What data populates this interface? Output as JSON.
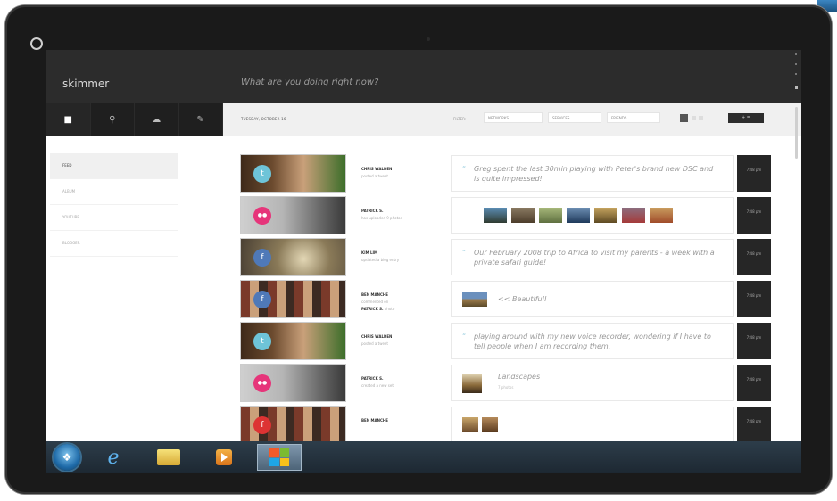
{
  "app": {
    "logo": "skimmer",
    "status_placeholder": "What are you doing right now?"
  },
  "nav_icons": [
    {
      "icon": "home-icon",
      "glyph": "■"
    },
    {
      "icon": "pin-icon",
      "glyph": "⚲"
    },
    {
      "icon": "cloud-icon",
      "glyph": "☁"
    },
    {
      "icon": "edit-icon",
      "glyph": "✎"
    }
  ],
  "filter_bar": {
    "date": "TUESDAY, OCTOBER 16",
    "filter_label": "FILTER:",
    "networks": "NETWORKS",
    "services": "SERVICES",
    "friends": "FRIENDS",
    "post_label": "+ ="
  },
  "sidebar": {
    "items": [
      {
        "label": "FEED",
        "active": true
      },
      {
        "label": "ALBUM",
        "active": false
      },
      {
        "label": "YOUTUBE",
        "active": false
      },
      {
        "label": "BLOGGER",
        "active": false
      }
    ]
  },
  "feed": [
    {
      "service": "twitter",
      "badge_glyph": "t",
      "badge_color": "#6ec4d8",
      "who": "CHRIS WALDEN",
      "what": "posted a tweet",
      "message": "Greg spent the last 30min playing with Peter's brand new DSC and is quite impressed!",
      "time": "7:48 pm"
    },
    {
      "service": "flickr",
      "badge_glyph": "●●",
      "badge_color": "#e6357a",
      "who": "PATRICK S.",
      "what": "has uploaded 9 photos",
      "photo_count": 9,
      "time": "7:48 pm"
    },
    {
      "service": "facebook",
      "badge_glyph": "f",
      "badge_color": "#4f79b8",
      "who": "KIM LIM",
      "what": "updated a blog entry",
      "message": "Our February 2008 trip to Africa to visit my parents - a week with a private safari guide!",
      "time": "7:48 pm"
    },
    {
      "service": "facebook",
      "badge_glyph": "f",
      "badge_color": "#4f79b8",
      "who": "BEN MANCHE",
      "what": "commented on",
      "who2": "PATRICK S.",
      "what2": "photo",
      "message": "<< Beautiful!",
      "time": "7:48 pm"
    },
    {
      "service": "twitter",
      "badge_glyph": "t",
      "badge_color": "#6ec4d8",
      "who": "CHRIS WALDEN",
      "what": "posted a tweet",
      "message": "playing around with my new voice recorder, wondering if I have to tell people when I am recording them.",
      "time": "7:48 pm"
    },
    {
      "service": "flickr",
      "badge_glyph": "●●",
      "badge_color": "#e6357a",
      "who": "PATRICK S.",
      "what": "created a new set",
      "title": "Landscapes",
      "subtitle": "7 photos",
      "time": "7:48 pm"
    },
    {
      "service": "facebook",
      "badge_glyph": "f",
      "badge_color": "#d33",
      "who": "BEN MANCHE",
      "what": "",
      "time": "7:48 pm"
    }
  ],
  "taskbar": {
    "items": [
      "start-orb",
      "internet-explorer",
      "file-explorer",
      "media-player",
      "windows-store"
    ]
  }
}
